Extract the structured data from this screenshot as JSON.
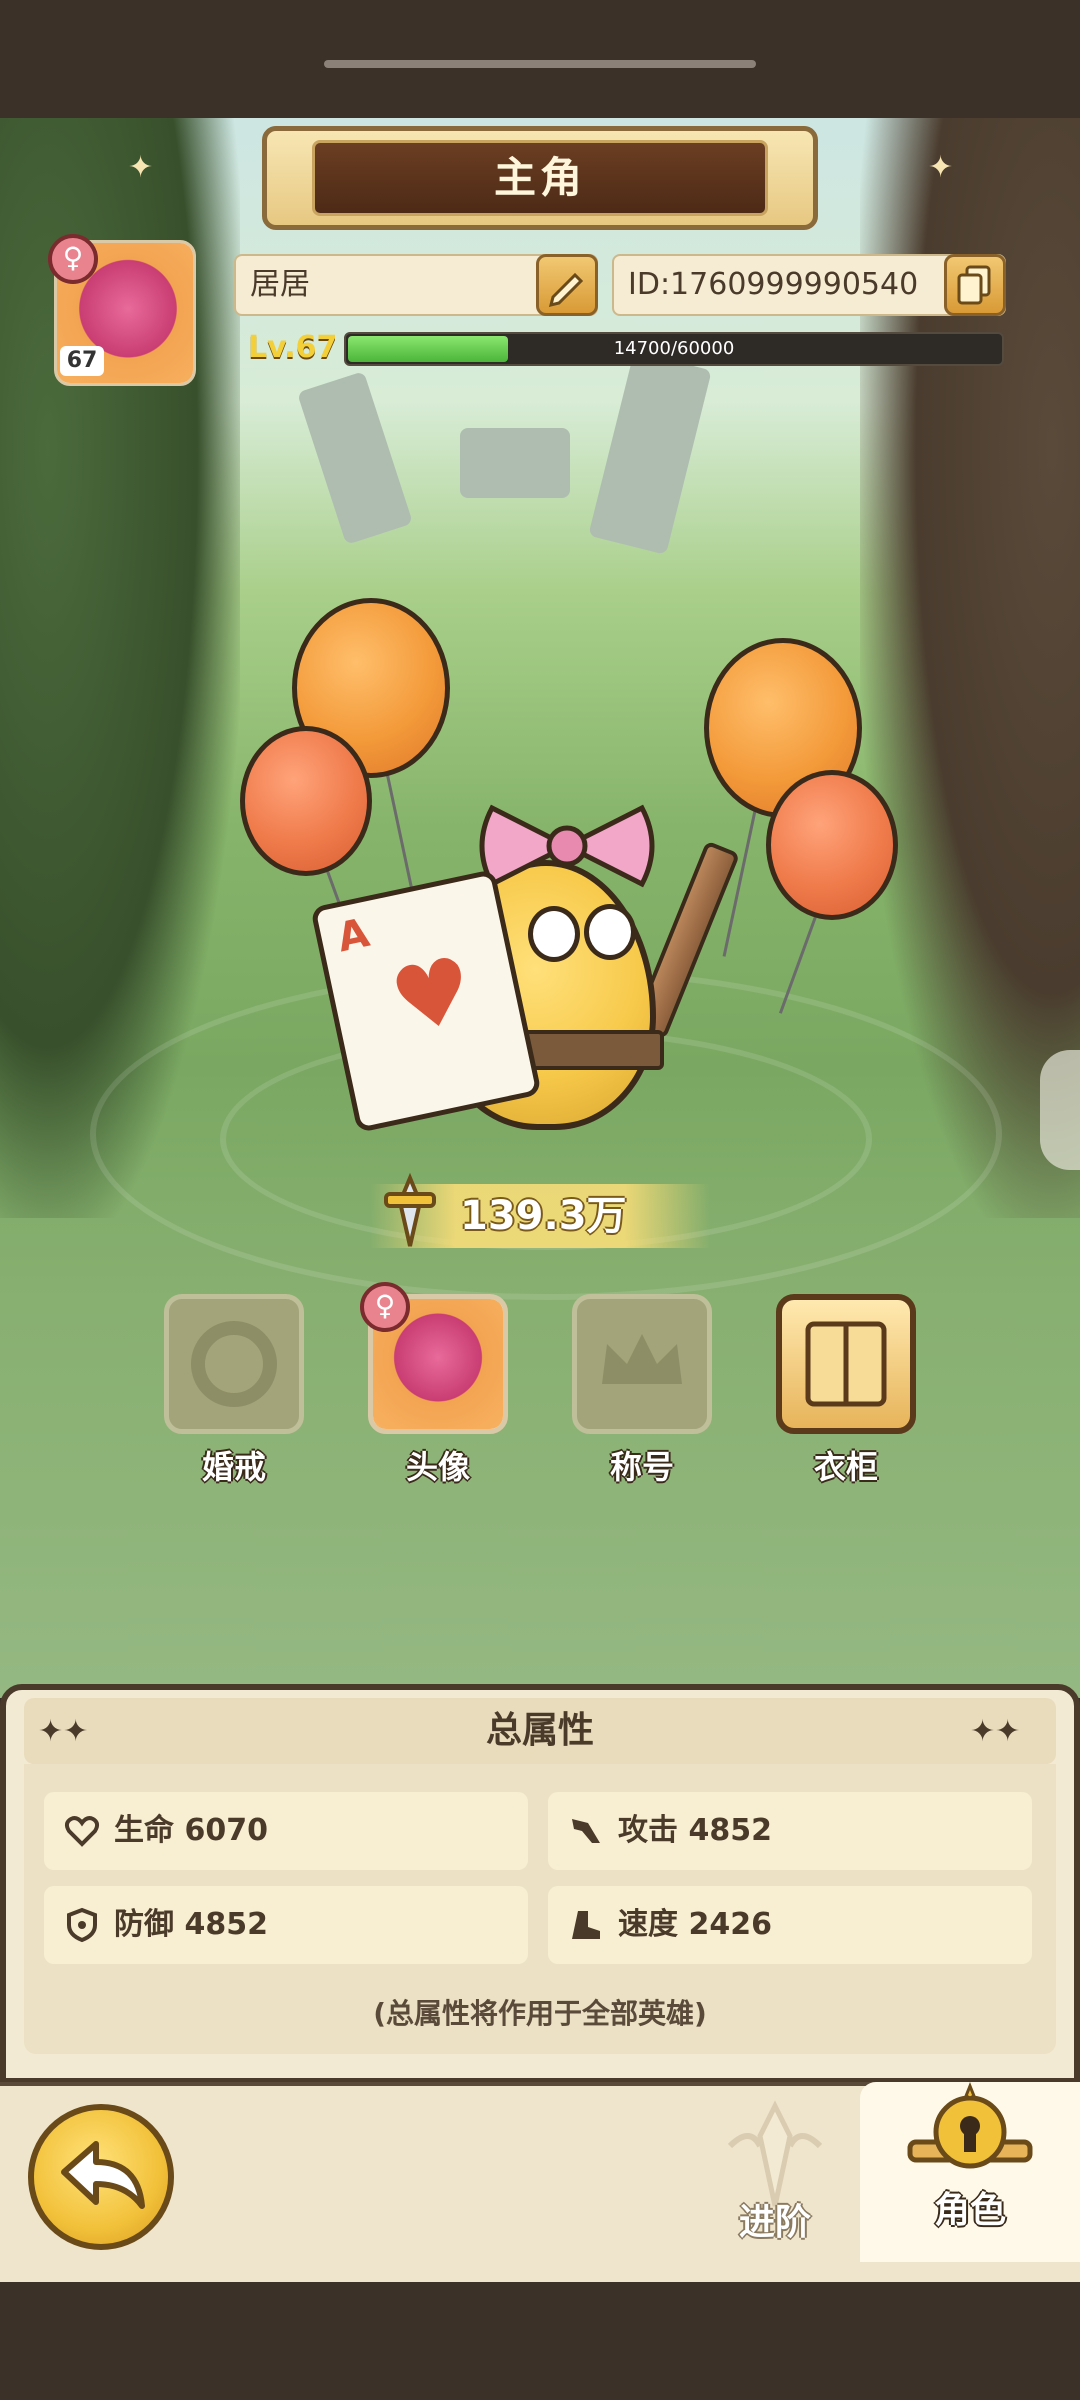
{
  "screen": {
    "title": "主角"
  },
  "profile": {
    "name": "居居",
    "id_text": "ID:1760999990540",
    "avatar_level": "67",
    "level_label": "Lv.67",
    "xp_current": 14700,
    "xp_max": 60000,
    "xp_text": "14700/60000",
    "gender_symbol": "♀"
  },
  "power": {
    "value": "139.3万"
  },
  "features": [
    {
      "label": "婚戒",
      "state": "locked",
      "icon": "ring-icon"
    },
    {
      "label": "头像",
      "state": "active",
      "icon": "avatar-icon"
    },
    {
      "label": "称号",
      "state": "locked",
      "icon": "crown-icon"
    },
    {
      "label": "衣柜",
      "state": "available",
      "icon": "wardrobe-icon"
    }
  ],
  "attributes": {
    "title": "总属性",
    "stats": [
      {
        "label": "生命 6070",
        "icon": "heart-icon"
      },
      {
        "label": "攻击 4852",
        "icon": "attack-icon"
      },
      {
        "label": "防御 4852",
        "icon": "shield-icon"
      },
      {
        "label": "速度 2426",
        "icon": "boot-icon"
      }
    ],
    "note": "(总属性将作用于全部英雄)"
  },
  "nav": {
    "advance_label": "进阶",
    "role_label": "角色"
  },
  "colors": {
    "gold": "#f2c13a",
    "panel": "#f3ead3",
    "dark_brown": "#4a3a2a",
    "xp_green": "#4bb53a"
  }
}
